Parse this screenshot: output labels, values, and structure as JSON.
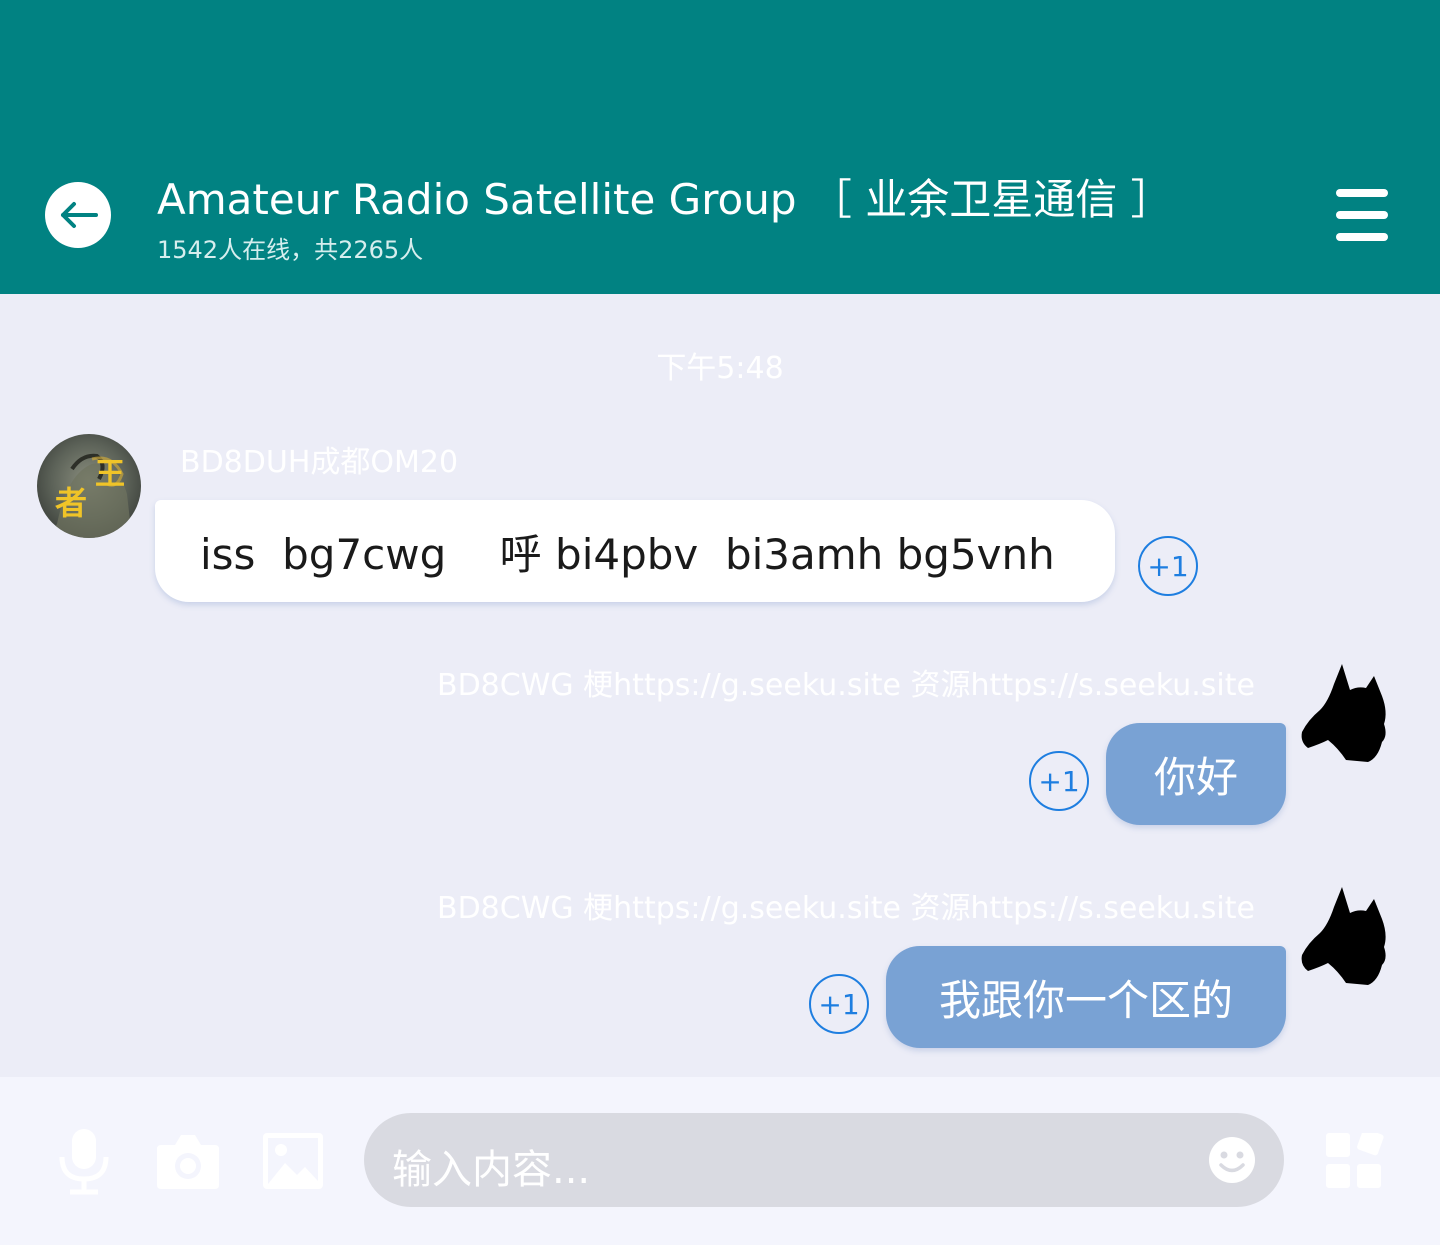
{
  "header": {
    "title": "Amateur Radio Satellite Group  ［ 业余卫星通信 ］",
    "subtitle": "1542人在线，共2265人",
    "back_icon": "back-arrow-icon",
    "menu_icon": "menu-icon",
    "color": "#018282"
  },
  "chat": {
    "timestamp": "下午5:48",
    "messages": [
      {
        "sender": "BD8DUH成都OM20",
        "text": "iss  bg7cwg    呼 bi4pbv  bi3amh bg5vnh",
        "direction": "incoming",
        "reaction": "+1"
      },
      {
        "sender": "BD8CWG 梗https://g.seeku.site  资源https://s.seeku.site",
        "text": "你好",
        "direction": "outgoing",
        "reaction": "+1"
      },
      {
        "sender": "BD8CWG 梗https://g.seeku.site  资源https://s.seeku.site",
        "text": "我跟你一个区的",
        "direction": "outgoing",
        "reaction": "+1"
      }
    ],
    "outgoing_bubble_color": "#79a2d4",
    "reaction_color": "#1e7ee0"
  },
  "input": {
    "placeholder": "输入内容...",
    "icons": [
      "microphone-icon",
      "camera-icon",
      "image-icon",
      "emoji-icon",
      "apps-icon"
    ]
  }
}
